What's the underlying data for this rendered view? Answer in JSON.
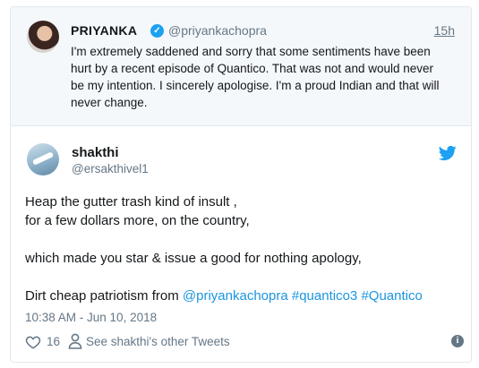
{
  "quoted_tweet": {
    "name": "PRIYANKA",
    "handle": "@priyankachopra",
    "time": "15h",
    "text": "I'm extremely saddened and sorry that some sentiments have been hurt by a recent episode of Quantico. That was not and would never be my intention. I sincerely apologise. I'm a proud Indian and that will never change."
  },
  "tweet": {
    "name": "shakthi",
    "handle": "@ersakthivel1",
    "lines": [
      "Heap the gutter trash kind of insult ,",
      "for a few dollars more,  on the country,",
      "which made you star & issue a good for nothing apology,"
    ],
    "last_line_prefix": "Dirt cheap patriotism from ",
    "mentions": [
      "@priyankachopra",
      "#quantico3",
      "#Quantico"
    ],
    "date": "10:38 AM - Jun 10, 2018"
  },
  "actions": {
    "likes": "16",
    "others_label": "See shakthi's other Tweets"
  },
  "colors": {
    "link": "#1b95e0",
    "twitter_blue": "#1da1f2",
    "muted": "#657786"
  },
  "icons": [
    "verified-icon",
    "twitter-bird-icon",
    "heart-icon",
    "person-icon",
    "info-icon"
  ]
}
